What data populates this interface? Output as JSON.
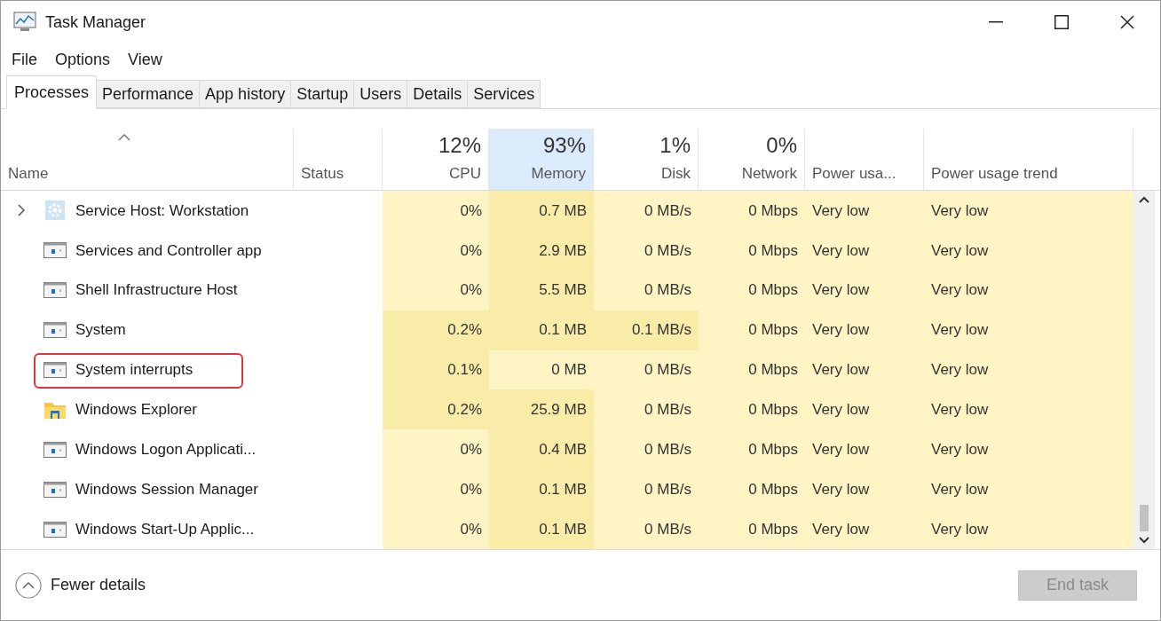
{
  "window": {
    "title": "Task Manager"
  },
  "menu": [
    "File",
    "Options",
    "View"
  ],
  "tabs": [
    {
      "label": "Processes",
      "selected": true
    },
    {
      "label": "Performance",
      "selected": false
    },
    {
      "label": "App history",
      "selected": false
    },
    {
      "label": "Startup",
      "selected": false
    },
    {
      "label": "Users",
      "selected": false
    },
    {
      "label": "Details",
      "selected": false
    },
    {
      "label": "Services",
      "selected": false
    }
  ],
  "columns": [
    {
      "label": "Name",
      "selected": false,
      "sorted": true
    },
    {
      "label": "Status",
      "selected": false
    },
    {
      "label": "CPU",
      "total": "12%",
      "selected": false
    },
    {
      "label": "Memory",
      "total": "93%",
      "selected": true
    },
    {
      "label": "Disk",
      "total": "1%",
      "selected": false
    },
    {
      "label": "Network",
      "total": "0%",
      "selected": false
    },
    {
      "label": "Power usa...",
      "selected": false
    },
    {
      "label": "Power usage trend",
      "selected": false
    }
  ],
  "rows": [
    {
      "name": "Service Host: Workstation",
      "kind": "service",
      "highlighted": false,
      "cells": [
        {
          "text": "0%",
          "color": "#fff4c4"
        },
        {
          "text": "0.7 MB",
          "color": "#f9eca8"
        },
        {
          "text": "0 MB/s",
          "color": "#fff4c4"
        },
        {
          "text": "0 Mbps",
          "color": "#fff4c4"
        },
        {
          "text": "Very low",
          "color": "#fff4c4"
        },
        {
          "text": "Very low",
          "color": "#fff4c4"
        }
      ]
    },
    {
      "name": "Services and Controller app",
      "kind": "app",
      "highlighted": false,
      "cells": [
        {
          "text": "0%",
          "color": "#fff4c4"
        },
        {
          "text": "2.9 MB",
          "color": "#f9eca8"
        },
        {
          "text": "0 MB/s",
          "color": "#fff4c4"
        },
        {
          "text": "0 Mbps",
          "color": "#fff4c4"
        },
        {
          "text": "Very low",
          "color": "#fff4c4"
        },
        {
          "text": "Very low",
          "color": "#fff4c4"
        }
      ]
    },
    {
      "name": "Shell Infrastructure Host",
      "kind": "app",
      "highlighted": false,
      "cells": [
        {
          "text": "0%",
          "color": "#fff4c4"
        },
        {
          "text": "5.5 MB",
          "color": "#f9eca8"
        },
        {
          "text": "0 MB/s",
          "color": "#fff4c4"
        },
        {
          "text": "0 Mbps",
          "color": "#fff4c4"
        },
        {
          "text": "Very low",
          "color": "#fff4c4"
        },
        {
          "text": "Very low",
          "color": "#fff4c4"
        }
      ]
    },
    {
      "name": "System",
      "kind": "app",
      "highlighted": false,
      "cells": [
        {
          "text": "0.2%",
          "color": "#f9eca8"
        },
        {
          "text": "0.1 MB",
          "color": "#f9eca8"
        },
        {
          "text": "0.1 MB/s",
          "color": "#f9eca8"
        },
        {
          "text": "0 Mbps",
          "color": "#fff4c4"
        },
        {
          "text": "Very low",
          "color": "#fff4c4"
        },
        {
          "text": "Very low",
          "color": "#fff4c4"
        }
      ]
    },
    {
      "name": "System interrupts",
      "kind": "app",
      "highlighted": true,
      "cells": [
        {
          "text": "0.1%",
          "color": "#f9eca8"
        },
        {
          "text": "0 MB",
          "color": "#fff4c4"
        },
        {
          "text": "0 MB/s",
          "color": "#fff4c4"
        },
        {
          "text": "0 Mbps",
          "color": "#fff4c4"
        },
        {
          "text": "Very low",
          "color": "#fff4c4"
        },
        {
          "text": "Very low",
          "color": "#fff4c4"
        }
      ]
    },
    {
      "name": "Windows Explorer",
      "kind": "explorer",
      "highlighted": false,
      "cells": [
        {
          "text": "0.2%",
          "color": "#f9eca8"
        },
        {
          "text": "25.9 MB",
          "color": "#f9eca8"
        },
        {
          "text": "0 MB/s",
          "color": "#fff4c4"
        },
        {
          "text": "0 Mbps",
          "color": "#fff4c4"
        },
        {
          "text": "Very low",
          "color": "#fff4c4"
        },
        {
          "text": "Very low",
          "color": "#fff4c4"
        }
      ]
    },
    {
      "name": "Windows Logon Applicati...",
      "kind": "app",
      "highlighted": false,
      "cells": [
        {
          "text": "0%",
          "color": "#fff4c4"
        },
        {
          "text": "0.4 MB",
          "color": "#f9eca8"
        },
        {
          "text": "0 MB/s",
          "color": "#fff4c4"
        },
        {
          "text": "0 Mbps",
          "color": "#fff4c4"
        },
        {
          "text": "Very low",
          "color": "#fff4c4"
        },
        {
          "text": "Very low",
          "color": "#fff4c4"
        }
      ]
    },
    {
      "name": "Windows Session Manager",
      "kind": "app",
      "highlighted": false,
      "cells": [
        {
          "text": "0%",
          "color": "#fff4c4"
        },
        {
          "text": "0.1 MB",
          "color": "#f9eca8"
        },
        {
          "text": "0 MB/s",
          "color": "#fff4c4"
        },
        {
          "text": "0 Mbps",
          "color": "#fff4c4"
        },
        {
          "text": "Very low",
          "color": "#fff4c4"
        },
        {
          "text": "Very low",
          "color": "#fff4c4"
        }
      ]
    },
    {
      "name": "Windows Start-Up Applic...",
      "kind": "app",
      "highlighted": false,
      "cells": [
        {
          "text": "0%",
          "color": "#fff4c4"
        },
        {
          "text": "0.1 MB",
          "color": "#f9eca8"
        },
        {
          "text": "0 MB/s",
          "color": "#fff4c4"
        },
        {
          "text": "0 Mbps",
          "color": "#fff4c4"
        },
        {
          "text": "Very low",
          "color": "#fff4c4"
        },
        {
          "text": "Very low",
          "color": "#fff4c4"
        }
      ]
    }
  ],
  "footer": {
    "toggle": "Fewer details",
    "button": {
      "label": "End task",
      "disabled": true
    }
  }
}
